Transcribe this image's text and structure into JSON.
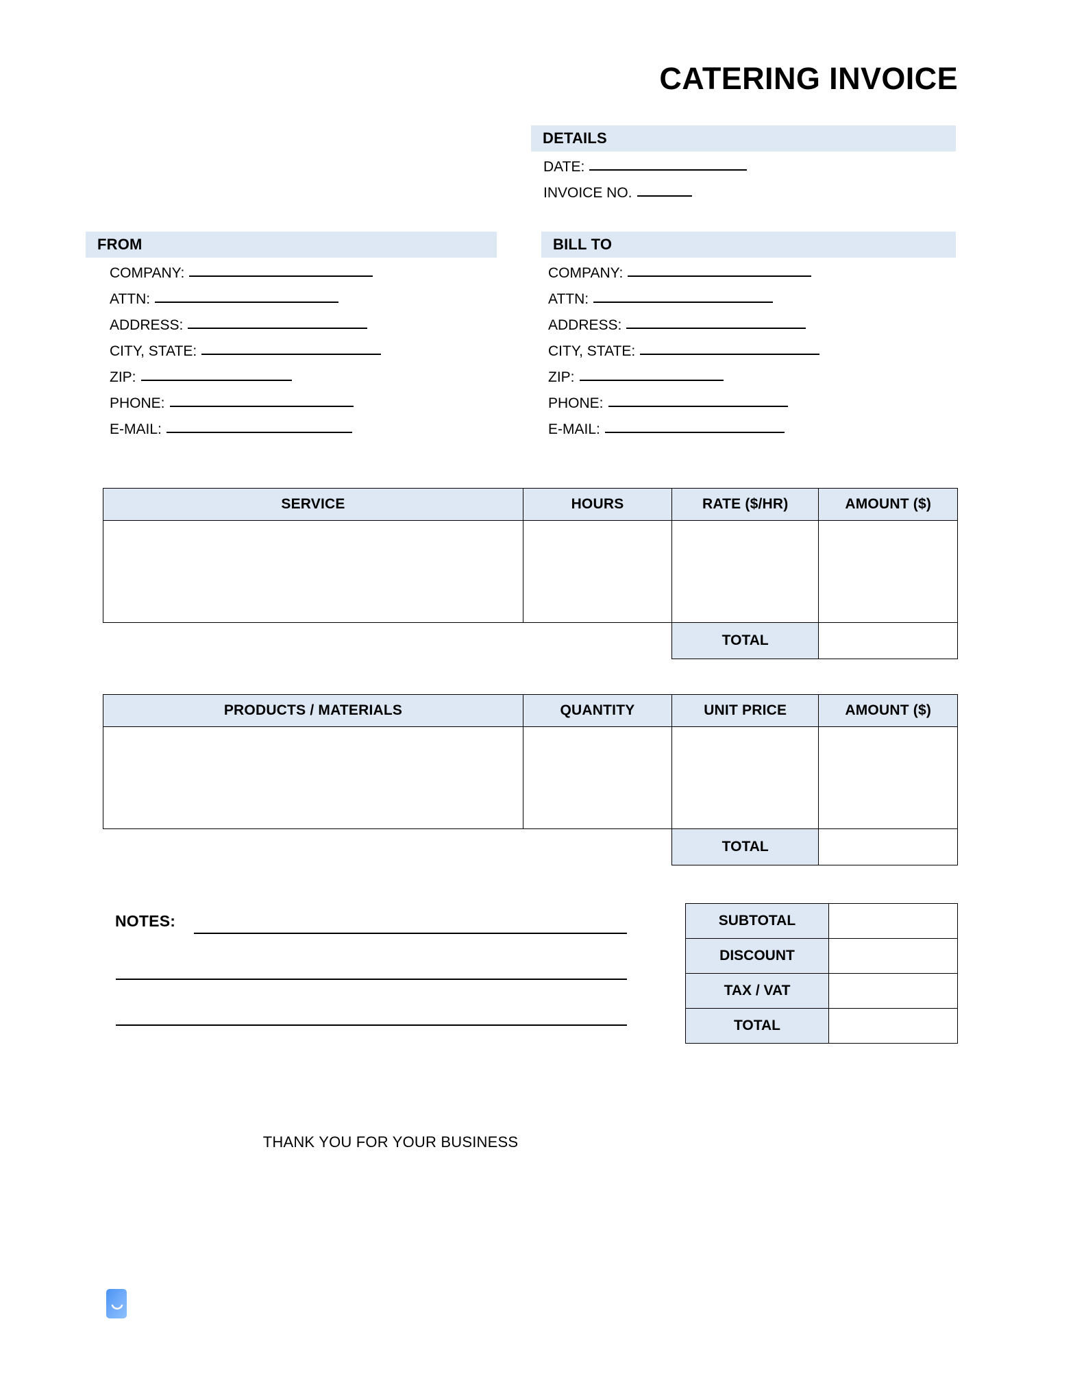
{
  "document": {
    "title": "CATERING INVOICE",
    "footer_note": "THANK YOU FOR YOUR BUSINESS"
  },
  "theme": {
    "header_fill": "#dde8f4",
    "border_color": "#000000",
    "page_background": "#ffffff",
    "logo_color": "#63a4f8"
  },
  "details": {
    "heading": "DETAILS",
    "fields": [
      {
        "label": "DATE:",
        "value": "",
        "rule_width": 230
      },
      {
        "label": "INVOICE NO.",
        "value": "",
        "rule_width": 80
      }
    ]
  },
  "from": {
    "heading": "FROM",
    "fields": [
      {
        "label": "COMPANY:",
        "value": "",
        "rule_width": 268
      },
      {
        "label": "ATTN:",
        "value": "",
        "rule_width": 268
      },
      {
        "label": "ADDRESS:",
        "value": "",
        "rule_width": 262
      },
      {
        "label": "CITY, STATE:",
        "value": "",
        "rule_width": 262
      },
      {
        "label": "ZIP:",
        "value": "",
        "rule_width": 220
      },
      {
        "label": "PHONE:",
        "value": "",
        "rule_width": 268
      },
      {
        "label": "E-MAIL:",
        "value": "",
        "rule_width": 271
      }
    ]
  },
  "bill_to": {
    "heading": "BILL TO",
    "fields": [
      {
        "label": "COMPANY:",
        "value": "",
        "rule_width": 268
      },
      {
        "label": "ATTN:",
        "value": "",
        "rule_width": 262
      },
      {
        "label": "ADDRESS:",
        "value": "",
        "rule_width": 262
      },
      {
        "label": "CITY, STATE:",
        "value": "",
        "rule_width": 262
      },
      {
        "label": "ZIP:",
        "value": "",
        "rule_width": 210
      },
      {
        "label": "PHONE:",
        "value": "",
        "rule_width": 262
      },
      {
        "label": "E-MAIL:",
        "value": "",
        "rule_width": 262
      }
    ]
  },
  "service_table": {
    "columns": [
      "SERVICE",
      "HOURS",
      "RATE ($/HR)",
      "AMOUNT ($)"
    ],
    "rows": [],
    "total_label": "TOTAL",
    "total_value": ""
  },
  "products_table": {
    "columns": [
      "PRODUCTS / MATERIALS",
      "QUANTITY",
      "UNIT PRICE",
      "AMOUNT ($)"
    ],
    "rows": [],
    "total_label": "TOTAL",
    "total_value": ""
  },
  "notes": {
    "label": "NOTES",
    "label_full": "NOTES:",
    "lines": [
      "",
      "",
      ""
    ]
  },
  "summary": {
    "rows": [
      {
        "label": "SUBTOTAL",
        "value": ""
      },
      {
        "label": "DISCOUNT",
        "value": ""
      },
      {
        "label": "TAX / VAT",
        "value": ""
      },
      {
        "label": "TOTAL",
        "value": ""
      }
    ]
  },
  "logo": {
    "icon": "document-smile-icon"
  }
}
